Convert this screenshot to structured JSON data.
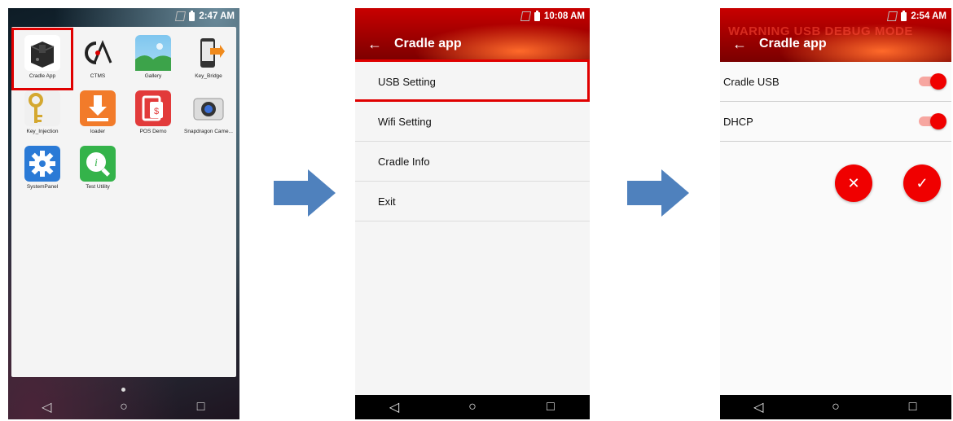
{
  "phone1": {
    "time": "2:47 AM",
    "apps": [
      {
        "label": "Cradle App",
        "icon": "cradle-device-icon"
      },
      {
        "label": "CTMS",
        "icon": "ctms-logo-icon"
      },
      {
        "label": "Gallery",
        "icon": "gallery-image-icon"
      },
      {
        "label": "Key_Bridge",
        "icon": "key-bridge-phone-icon"
      },
      {
        "label": "Key_Injection",
        "icon": "key-icon"
      },
      {
        "label": "loader",
        "icon": "download-icon"
      },
      {
        "label": "POS Demo",
        "icon": "pos-terminal-icon"
      },
      {
        "label": "Snapdragon Came...",
        "icon": "camera-icon"
      },
      {
        "label": "SystemPanel",
        "icon": "gear-icon"
      },
      {
        "label": "Test Utility",
        "icon": "magnifier-info-icon"
      }
    ],
    "nav": {
      "back": "◁",
      "home": "○",
      "recent": "□"
    }
  },
  "phone2": {
    "time": "10:08 AM",
    "title": "Cradle app",
    "menu": [
      "USB Setting",
      "Wifi Setting",
      "Cradle Info",
      "Exit"
    ],
    "nav": {
      "back": "◁",
      "home": "○",
      "recent": "□"
    }
  },
  "phone3": {
    "time": "2:54 AM",
    "title": "Cradle app",
    "warning": "WARNING USB DEBUG MODE",
    "settings": [
      {
        "label": "Cradle USB",
        "on": true
      },
      {
        "label": "DHCP",
        "on": true
      }
    ],
    "cancel": "✕",
    "confirm": "✓",
    "nav": {
      "back": "◁",
      "home": "○",
      "recent": "□"
    }
  },
  "colors": {
    "accent_red": "#f00000",
    "highlight": "#e00000",
    "arrow": "#4f81bd"
  }
}
